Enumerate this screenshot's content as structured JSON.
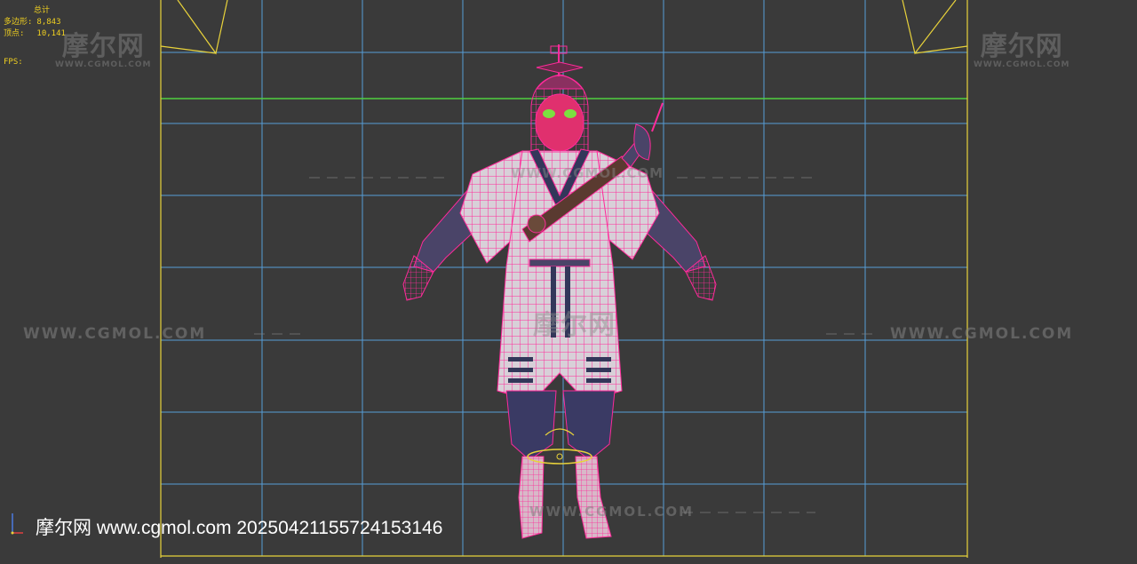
{
  "viewport": {
    "name": "front-viewport",
    "background": "#3a3a3a",
    "grid_color": "#5aa8e8",
    "safe_frame_color": "#e8d23a",
    "horizon_color": "#50d040",
    "selection_color": "#ff2a9a"
  },
  "stats": {
    "title": "总计",
    "polygons_label": "多边形:",
    "polygons_value": "8,843",
    "vertices_label": "顶点:",
    "vertices_value": "10,141",
    "fps_label": "FPS:"
  },
  "watermarks": {
    "logo_cn": "摩尔网",
    "logo_en": "WWW.CGMOL.COM",
    "url": "WWW.CGMOL.COM"
  },
  "caption": "摩尔网 www.cgmol.com 20250421155724153146"
}
